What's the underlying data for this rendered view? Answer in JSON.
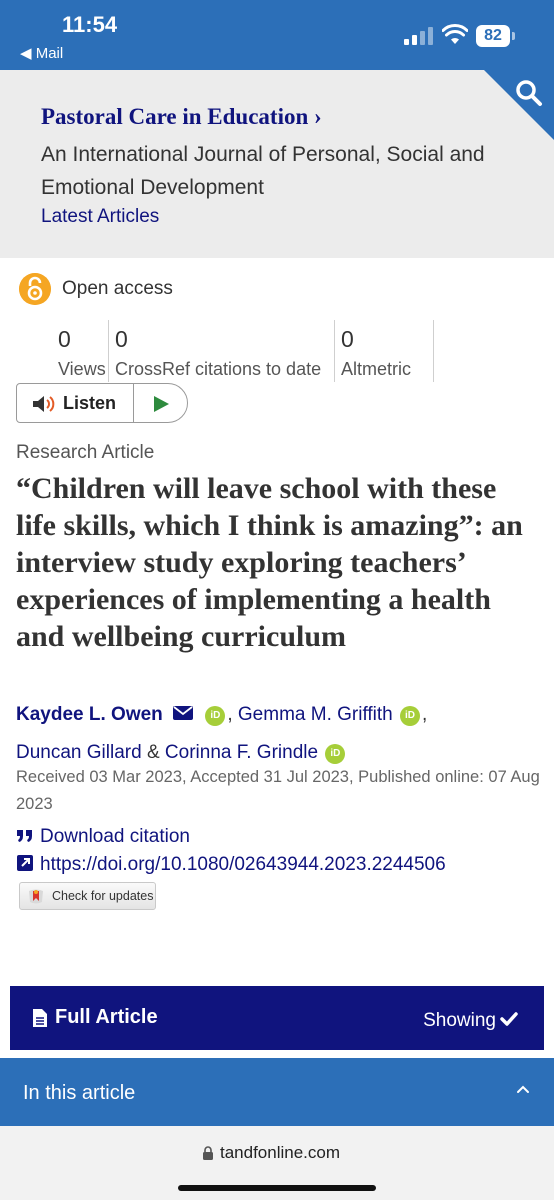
{
  "status_bar": {
    "time": "11:54",
    "back_label": "Mail",
    "battery": "82"
  },
  "journal": {
    "title": "Pastoral Care in Education",
    "title_chevron": "›",
    "subtitle": "An International Journal of Personal, Social and Emotional Development",
    "latest_articles": "Latest Articles"
  },
  "access": {
    "label": "Open access"
  },
  "metrics": [
    {
      "value": "0",
      "label": "Views"
    },
    {
      "value": "0",
      "label": "CrossRef citations to date"
    },
    {
      "value": "0",
      "label": "Altmetric"
    }
  ],
  "listen": {
    "label": "Listen"
  },
  "article": {
    "type": "Research Article",
    "title": "“Children will leave school with these life skills, which I think is amazing”: an interview study exploring teachers’ experiences of implementing a health and wellbeing curriculum",
    "authors": [
      {
        "name": "Kaydee L. Owen"
      },
      {
        "name": "Gemma M. Griffith"
      },
      {
        "name": "Duncan Gillard"
      },
      {
        "name": "Corinna F. Grindle"
      }
    ],
    "separators": {
      "comma": ",",
      "amp": "&"
    },
    "orcid_text": "iD",
    "dates": "Received 03 Mar 2023, Accepted 31 Jul 2023, Published online: 07 Aug 2023",
    "download_citation": "Download citation",
    "doi": "https://doi.org/10.1080/02643944.2023.2244506",
    "check_updates": "Check for updates"
  },
  "full_article": {
    "label": "Full Article",
    "status": "Showing"
  },
  "in_this_article": {
    "label": "In this article"
  },
  "browser": {
    "url": "tandfonline.com"
  },
  "colors": {
    "brand_blue": "#2c6fb8",
    "navy": "#10147e",
    "orcid_green": "#a6ce39",
    "open_access_orange": "#f5a623"
  },
  "icons": [
    "search-icon",
    "open-access-icon",
    "speaker-icon",
    "play-icon",
    "envelope-icon",
    "orcid-icon",
    "quote-icon",
    "external-link-icon",
    "check-updates-icon",
    "document-icon",
    "check-icon",
    "chevron-up-icon",
    "lock-icon"
  ]
}
